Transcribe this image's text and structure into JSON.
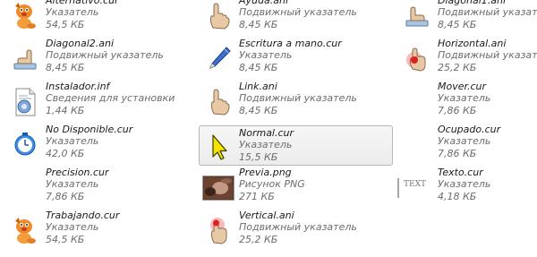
{
  "files": [
    {
      "name": "Alternativo.cur",
      "type": "Указатель",
      "size": "54,5 КБ",
      "icon": "orange-dog-cursor-icon"
    },
    {
      "name": "Ayuda.ani",
      "type": "Подвижный указатель",
      "size": "8,45 КБ",
      "icon": "hand-help-cursor-icon"
    },
    {
      "name": "Diagonal1.ani",
      "type": "Подвижный указатель",
      "size": "8,45 КБ",
      "icon": "hand-diagonal-cursor-icon"
    },
    {
      "name": "Diagonal2.ani",
      "type": "Подвижный указатель",
      "size": "8,45 КБ",
      "icon": "hand-diagonal-cursor-icon"
    },
    {
      "name": "Escritura a mano.cur",
      "type": "Указатель",
      "size": "8,45 КБ",
      "icon": "pencil-cursor-icon"
    },
    {
      "name": "Horizontal.ani",
      "type": "Подвижный указатель",
      "size": "25,2 КБ",
      "icon": "hand-red-cursor-icon"
    },
    {
      "name": "Instalador.inf",
      "type": "Сведения для установки",
      "size": "1,44 КБ",
      "icon": "setup-info-file-icon"
    },
    {
      "name": "Link.ani",
      "type": "Подвижный указатель",
      "size": "8,45 КБ",
      "icon": "hand-link-cursor-icon"
    },
    {
      "name": "Mover.cur",
      "type": "Указатель",
      "size": "7,86 КБ",
      "icon": ""
    },
    {
      "name": "No Disponible.cur",
      "type": "Указатель",
      "size": "42,0 КБ",
      "icon": "unavailable-clock-cursor-icon"
    },
    {
      "name": "Normal.cur",
      "type": "Указатель",
      "size": "15,5 КБ",
      "icon": "yellow-arrow-cursor-icon"
    },
    {
      "name": "Ocupado.cur",
      "type": "Указатель",
      "size": "7,86 КБ",
      "icon": ""
    },
    {
      "name": "Precision.cur",
      "type": "Указатель",
      "size": "7,86 КБ",
      "icon": ""
    },
    {
      "name": "Previa.png",
      "type": "Рисунок PNG",
      "size": "271 КБ",
      "icon": "image-thumbnail-icon"
    },
    {
      "name": "Texto.cur",
      "type": "Указатель",
      "size": "4,18 КБ",
      "icon": "text-beam-cursor-icon"
    },
    {
      "name": "Trabajando.cur",
      "type": "Указатель",
      "size": "54,5 КБ",
      "icon": "orange-dog-cursor-icon"
    },
    {
      "name": "Vertical.ani",
      "type": "Подвижный указатель",
      "size": "25,2 КБ",
      "icon": "hand-red-cursor-icon"
    }
  ],
  "text_cursor_label": "TEXT",
  "selected_index": 10,
  "colors": {
    "selection_bg": "#ececec",
    "selection_border": "#b8b8b8",
    "secondary_text": "#6d6d6d"
  }
}
